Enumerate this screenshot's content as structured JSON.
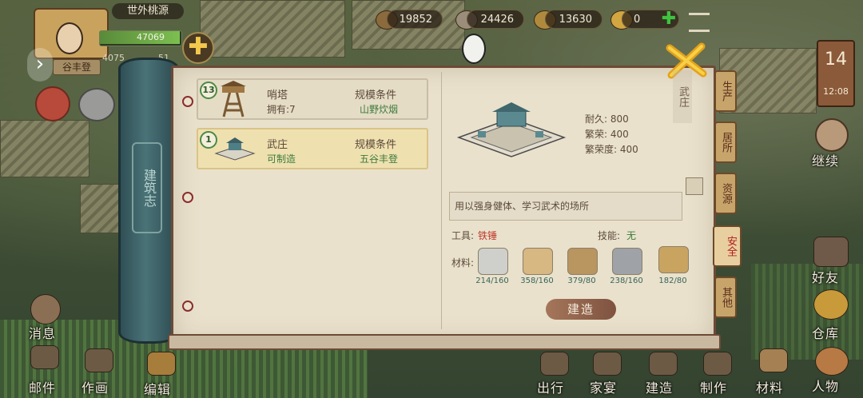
{
  "top": {
    "location_name": "世外桃源",
    "player_name": "谷丰登",
    "exp_value": "47069",
    "score_partial": "4075",
    "score_tail": "51",
    "resources": [
      {
        "icon": "wood-log-icon",
        "value": "19852"
      },
      {
        "icon": "stone-icon",
        "value": "24426"
      },
      {
        "icon": "coin-icon",
        "value": "13630"
      },
      {
        "icon": "ticket-icon",
        "value": "0"
      }
    ],
    "day_number": "14",
    "clock": "12:08"
  },
  "panel": {
    "spine_title": "建筑志",
    "list": [
      {
        "badge": "13",
        "name": "哨塔",
        "owned": "拥有:7",
        "cond_label": "规模条件",
        "cond_value": "山野炊烟",
        "selected": false
      },
      {
        "badge": "1",
        "name": "武庄",
        "owned": "可制造",
        "cond_label": "规模条件",
        "cond_value": "五谷丰登",
        "selected": true
      }
    ],
    "detail": {
      "title_vertical": "武庄",
      "durability": "耐久: 800",
      "prosperity": "繁荣: 400",
      "prosperity_degree": "繁荣度: 400",
      "description": "用以强身健体、学习武术的场所",
      "tool_label": "工具:",
      "tool_value": "铁锤",
      "skill_label": "技能:",
      "skill_value": "无",
      "material_label": "材料:",
      "materials": [
        {
          "icon": "cloth-icon",
          "qty": "214/160"
        },
        {
          "icon": "plank-icon",
          "qty": "358/160"
        },
        {
          "icon": "scroll-icon",
          "qty": "379/80"
        },
        {
          "icon": "iron-icon",
          "qty": "238/160"
        },
        {
          "icon": "bucket-icon",
          "qty": "182/80"
        }
      ],
      "build_button": "建造"
    },
    "tabs": [
      {
        "label": "生产",
        "active": false
      },
      {
        "label": "居所",
        "active": false
      },
      {
        "label": "资源",
        "active": false
      },
      {
        "label": "安全",
        "active": true
      },
      {
        "label": "其他",
        "active": false
      }
    ]
  },
  "right_menu": {
    "continue": "继续",
    "friends": "好友",
    "warehouse": "仓库",
    "characters": "人物"
  },
  "bottom_nav": [
    "邮件",
    "作画",
    "编辑",
    "出行",
    "家宴",
    "建造",
    "制作",
    "材料"
  ],
  "left_menu": {
    "messages": "消息"
  },
  "colors": {
    "accent_green": "#3b7a3b",
    "tool_red": "#c0392b",
    "panel_bg": "#e9e1cc",
    "spine": "#3c5f64"
  }
}
